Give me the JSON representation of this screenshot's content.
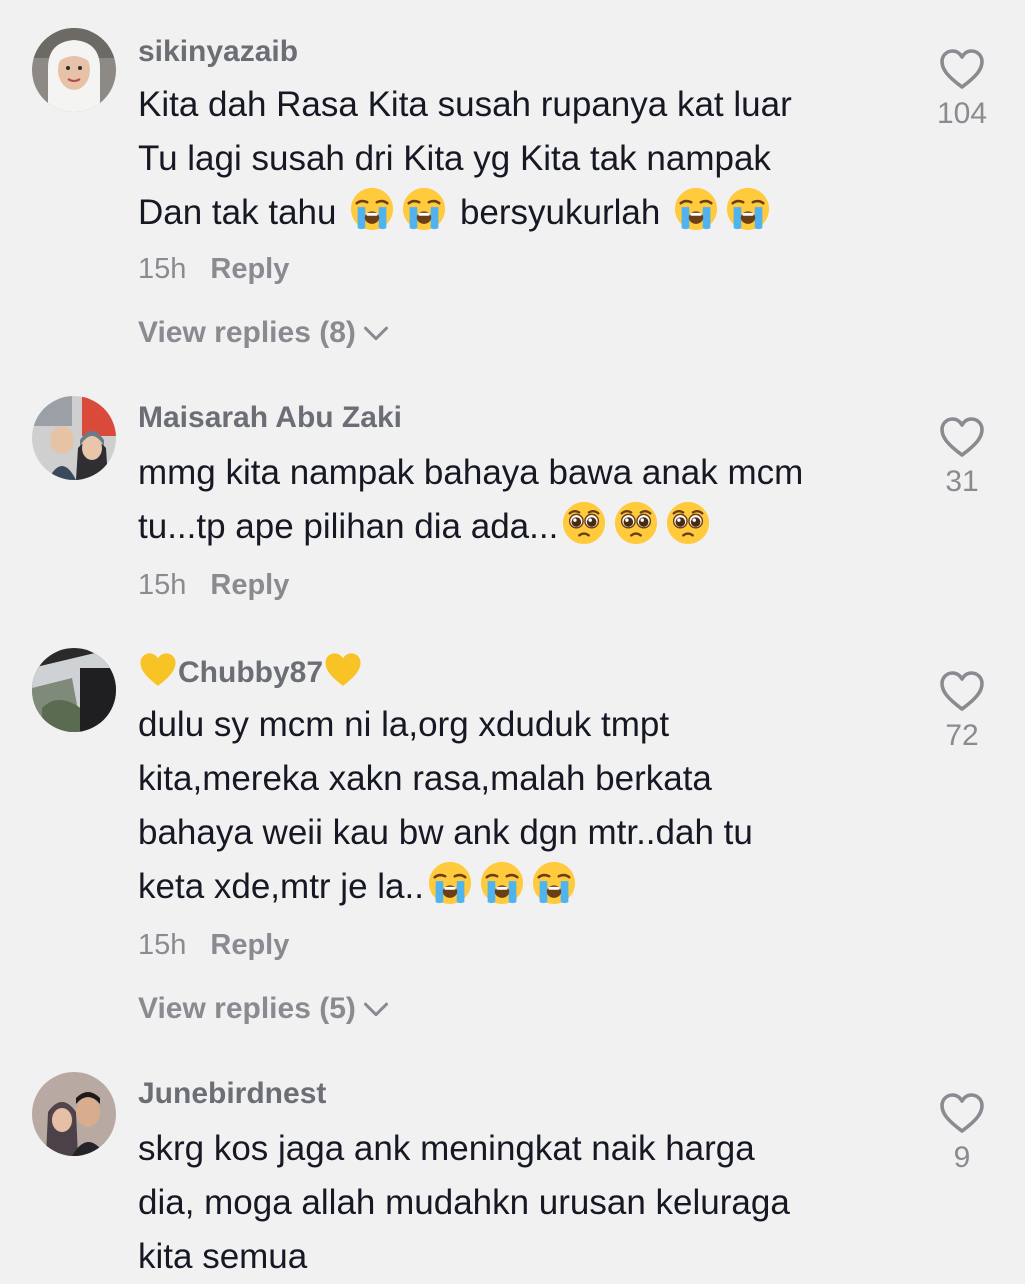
{
  "comments": [
    {
      "username": "sikinyazaib",
      "lines": [
        "Kita dah Rasa Kita susah rupanya kat luar",
        "Tu lagi susah dri Kita yg Kita tak nampak",
        "Dan tak tahu",
        "bersyukurlah"
      ],
      "time": "15h",
      "reply_label": "Reply",
      "view_replies": "View replies (8)",
      "likes": "104"
    },
    {
      "username": "Maisarah Abu Zaki",
      "lines": [
        "mmg kita nampak bahaya bawa anak mcm",
        "tu...tp ape pilihan dia ada..."
      ],
      "time": "15h",
      "reply_label": "Reply",
      "likes": "31"
    },
    {
      "username": "Chubby87",
      "lines": [
        "dulu sy mcm ni la,org xduduk tmpt",
        "kita,mereka xakn rasa,malah berkata",
        "bahaya weii kau bw ank dgn mtr..dah tu",
        "keta xde,mtr je la.."
      ],
      "time": "15h",
      "reply_label": "Reply",
      "view_replies": "View replies (5)",
      "likes": "72"
    },
    {
      "username": "Junebirdnest",
      "lines": [
        "skrg kos jaga ank meningkat naik harga",
        "dia, moga allah mudahkn urusan keluraga",
        "kita semua"
      ],
      "likes": "9"
    }
  ],
  "icons": {
    "like": "heart-outline-icon",
    "expand": "chevron-down-icon",
    "emoji_crying": "loudly-crying-face-emoji",
    "emoji_pleading": "pleading-face-emoji",
    "username_decoration": "yellow-heart-emoji"
  },
  "colors": {
    "background": "#f1f1f1",
    "text": "#161823",
    "muted": "#8a8b91",
    "username": "#6c6e75",
    "yellow_heart": "#f7c325"
  }
}
